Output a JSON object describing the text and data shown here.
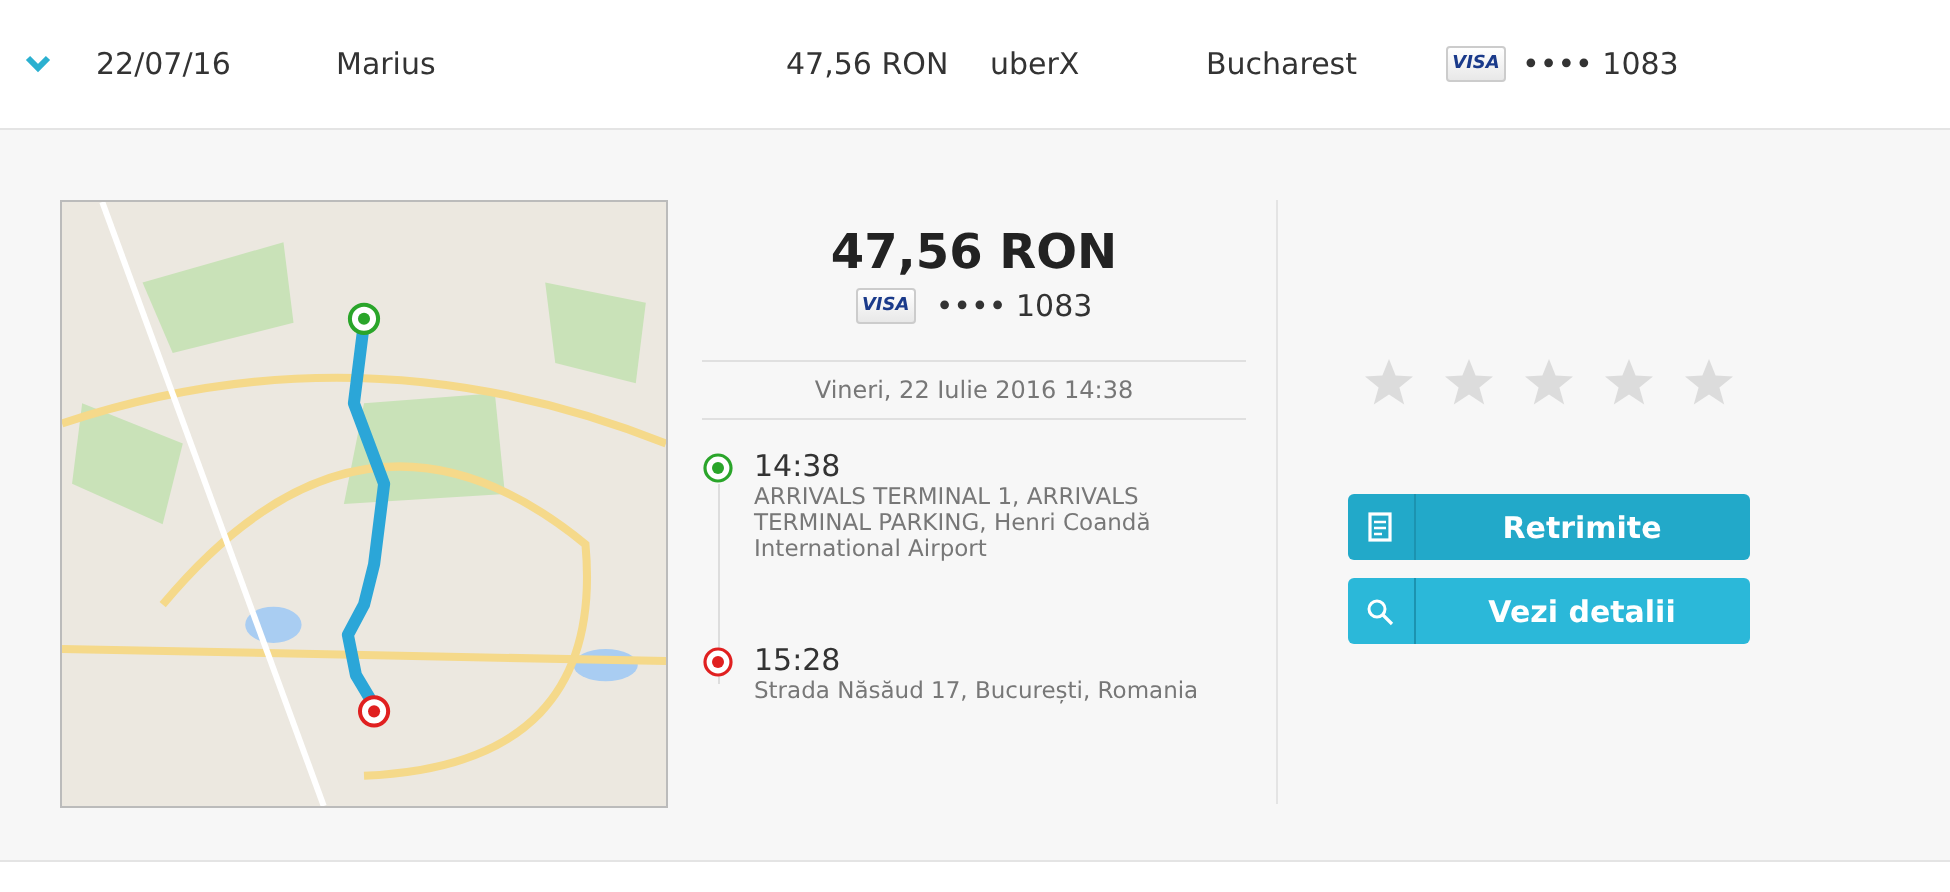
{
  "trip_row": {
    "expanded": true,
    "date": "22/07/16",
    "driver": "Marius",
    "fare": "47,56 RON",
    "vehicle": "uberX",
    "city": "Bucharest",
    "card_brand": "VISA",
    "card_number": "•••• 1083"
  },
  "detail": {
    "fare": "47,56 RON",
    "card_brand": "VISA",
    "card_number": "•••• 1083",
    "datetime": "Vineri, 22 Iulie 2016 14:38",
    "stops": [
      {
        "kind": "pickup",
        "time": "14:38",
        "address": "ARRIVALS TERMINAL 1, ARRIVALS TERMINAL PARKING, Henri Coandă International Airport"
      },
      {
        "kind": "dropoff",
        "time": "15:28",
        "address": "Strada Năsăud 17, București, Romania"
      }
    ],
    "stars": 0,
    "buttons": [
      {
        "kind": "receipt",
        "label": "Retrimite"
      },
      {
        "kind": "search",
        "label": "Vezi detalii"
      }
    ]
  }
}
